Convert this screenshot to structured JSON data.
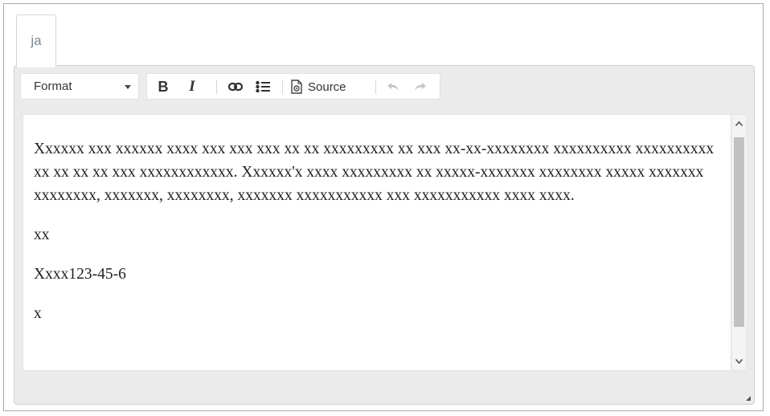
{
  "tab": {
    "label": "ja"
  },
  "toolbar": {
    "format_label": "Format",
    "bold_label": "B",
    "italic_label": "I",
    "source_label": "Source"
  },
  "content": {
    "paragraphs": [
      "Xxxxxx xxx xxxxxx xxxx xxx xxx xxx xx xx xxxxxxxxx xx xxx xx-xx-xxxxxxxx xxxxxxxxxx xxxxxxxxxx xx xx xx xx xxx xxxxxxxxxxxx. Xxxxxx'x xxxx xxxxxxxxx xx xxxxx-xxxxxxx xxxxxxxx xxxxx xxxxxxx xxxxxxxx, xxxxxxx, xxxxxxxx, xxxxxxx xxxxxxxxxxx xxx xxxxxxxxxxx xxxx xxxx.",
      "xx",
      "Xxxx123-45-6",
      "x"
    ]
  },
  "colors": {
    "editor_bg": "#ebebeb",
    "tab_text": "#7b8794",
    "scroll_thumb": "#c1c1c1"
  },
  "icons": [
    "chevron-down-icon",
    "link-icon",
    "bulleted-list-icon",
    "source-icon",
    "undo-icon",
    "redo-icon",
    "scroll-up-arrow",
    "scroll-down-arrow",
    "resize-handle-icon"
  ]
}
